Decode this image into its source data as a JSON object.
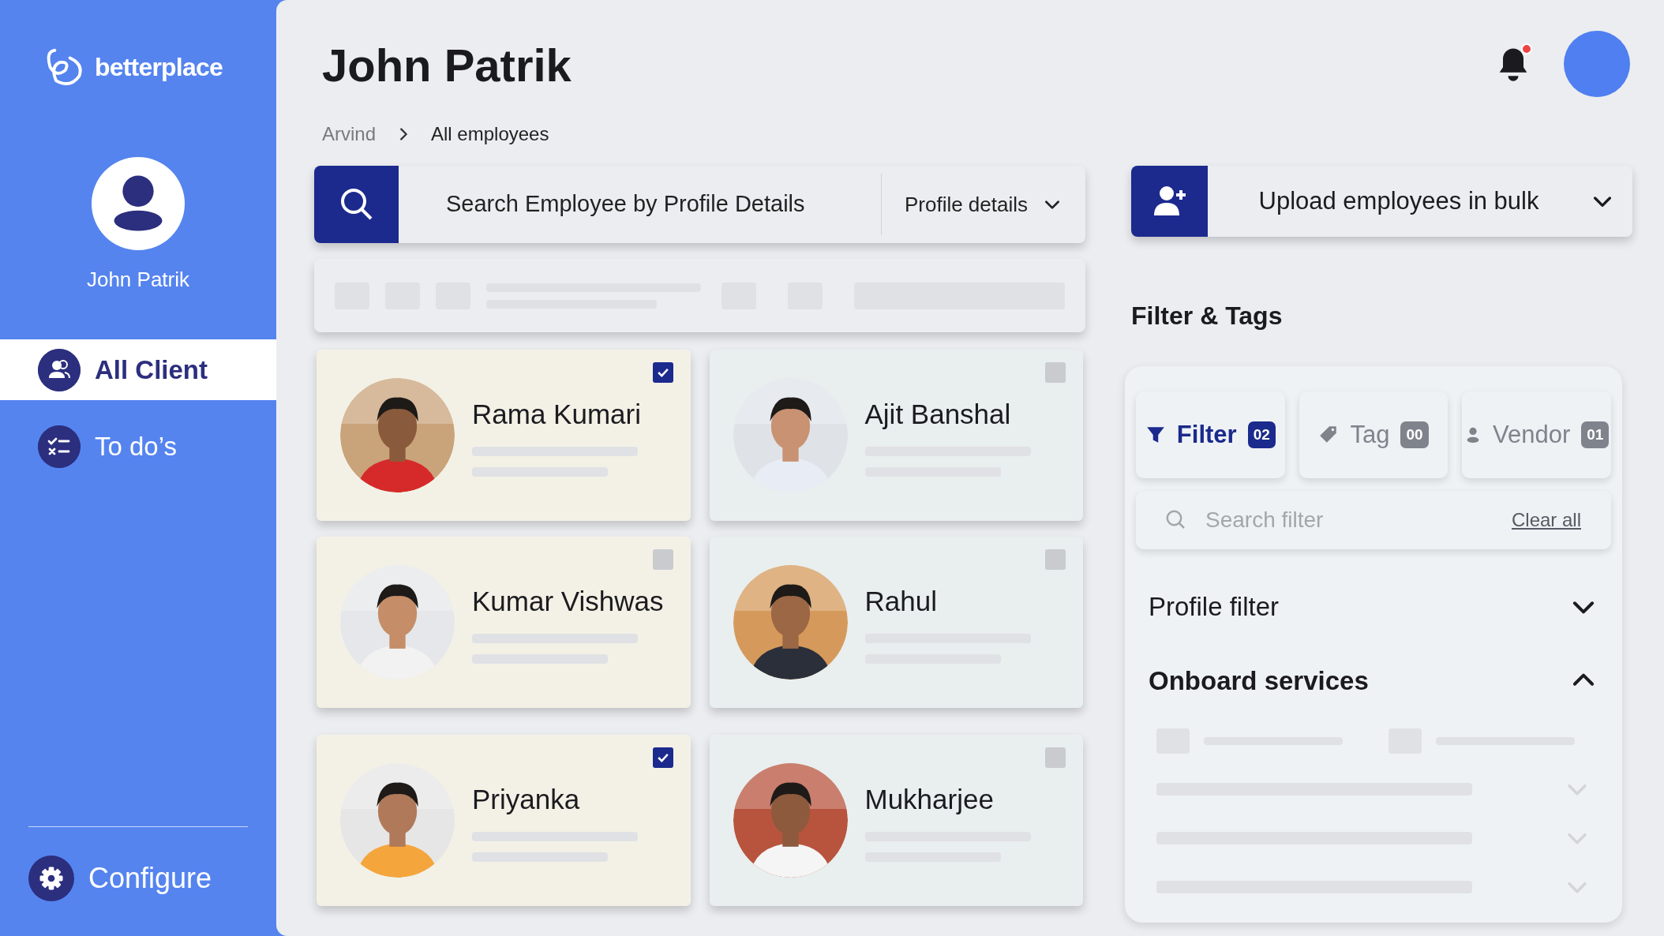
{
  "brand": {
    "name": "betterplace"
  },
  "user": {
    "name": "John Patrik"
  },
  "nav": [
    {
      "label": "All Client",
      "selected": true
    },
    {
      "label": "To do’s",
      "selected": false
    }
  ],
  "configure": {
    "label": "Configure"
  },
  "header": {
    "title": "John Patrik",
    "breadcrumb": [
      "Arvind",
      "All employees"
    ],
    "notification": true
  },
  "search": {
    "placeholder": "Search Employee by Profile Details",
    "dropdown": "Profile details"
  },
  "employees": [
    {
      "name": "Rama Kumari",
      "checked": true
    },
    {
      "name": "Ajit Banshal",
      "checked": false
    },
    {
      "name": "Kumar Vishwas",
      "checked": false
    },
    {
      "name": "Rahul",
      "checked": false
    },
    {
      "name": "Priyanka",
      "checked": true
    },
    {
      "name": "Mukharjee",
      "checked": false
    }
  ],
  "upload": {
    "label": "Upload employees in bulk"
  },
  "filters": {
    "title": "Filter & Tags",
    "tabs": [
      {
        "label": "Filter",
        "count": "02",
        "selected": true
      },
      {
        "label": "Tag",
        "count": "00",
        "selected": false
      },
      {
        "label": "Vendor",
        "count": "01",
        "selected": false
      }
    ],
    "search_placeholder": "Search filter",
    "clear": "Clear all",
    "sections": [
      {
        "label": "Profile filter",
        "expanded": false
      },
      {
        "label": "Onboard services",
        "expanded": true
      }
    ]
  }
}
